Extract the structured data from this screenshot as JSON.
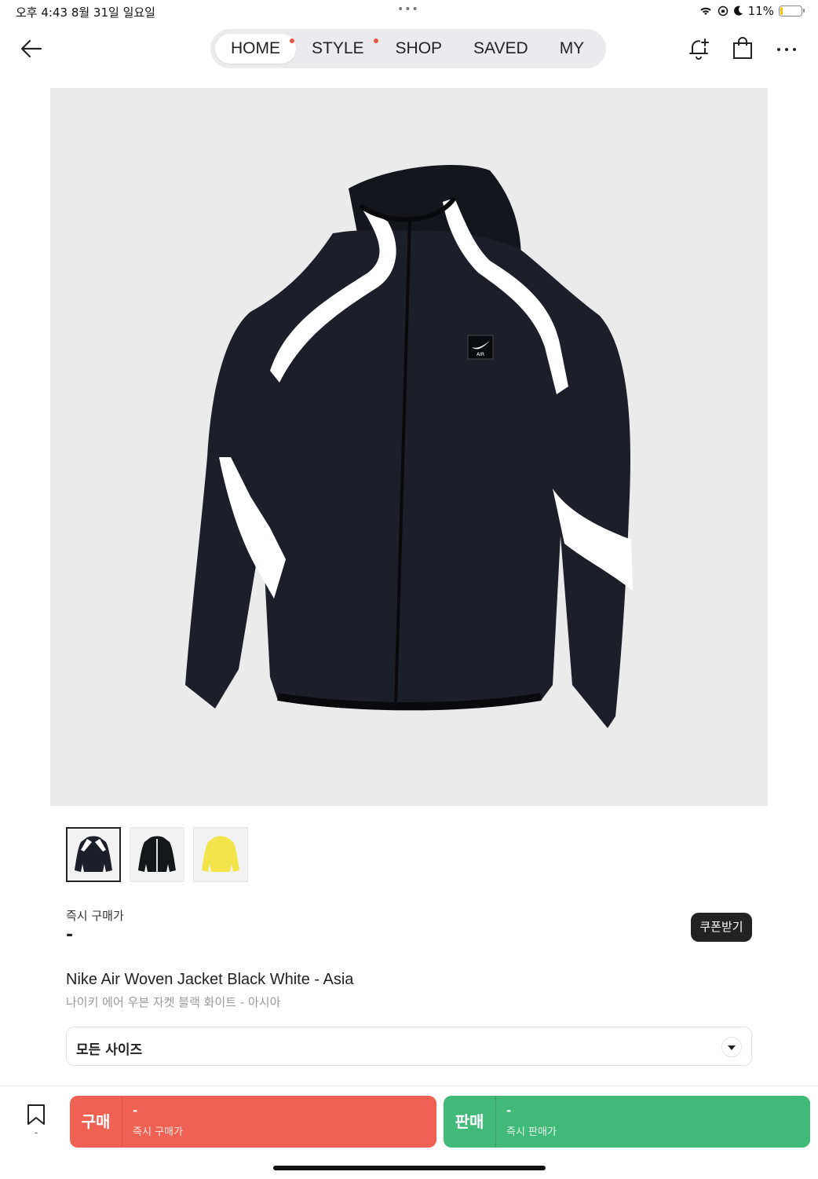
{
  "status_bar": {
    "time": "오후 4:43   8월 31일 일요일",
    "dots": "•••",
    "battery": "11%",
    "battery_level": 0.11
  },
  "nav": {
    "tabs": [
      {
        "label": "HOME",
        "active": true,
        "dot": true
      },
      {
        "label": "STYLE",
        "active": false,
        "dot": true
      },
      {
        "label": "SHOP",
        "active": false,
        "dot": false
      },
      {
        "label": "SAVED",
        "active": false,
        "dot": false
      },
      {
        "label": "MY",
        "active": false,
        "dot": false
      }
    ]
  },
  "header_icons": [
    "back-arrow-icon",
    "bell-plus-icon",
    "shopping-bag-icon",
    "more-icon"
  ],
  "colors": {
    "buy": "#ef6253",
    "sell": "#41b979",
    "dark": "#222222",
    "jacket_body": "#1c1f28",
    "jacket_panel": "#ffffff",
    "thumb_yellow": "#f2e44a"
  },
  "thumbnails": [
    {
      "name": "black-white-jacket",
      "active": true
    },
    {
      "name": "black-jacket-alt",
      "active": false
    },
    {
      "name": "yellow-jacket",
      "active": false
    }
  ],
  "product": {
    "price_label": "즉시 구매가",
    "price_value": "-",
    "coupon_label": "쿠폰받기",
    "name_en": "Nike Air Woven Jacket Black White - Asia",
    "name_ko": "나이키 에어 우븐 자켓 블랙 화이트 - 아시아",
    "logo_text": "AIR"
  },
  "size_select": {
    "value": "모든 사이즈"
  },
  "bottom": {
    "wish_count": "-",
    "buy": {
      "label": "구매",
      "amount": "-",
      "sub": "즉시 구매가"
    },
    "sell": {
      "label": "판매",
      "amount": "-",
      "sub": "즉시 판매가"
    }
  }
}
